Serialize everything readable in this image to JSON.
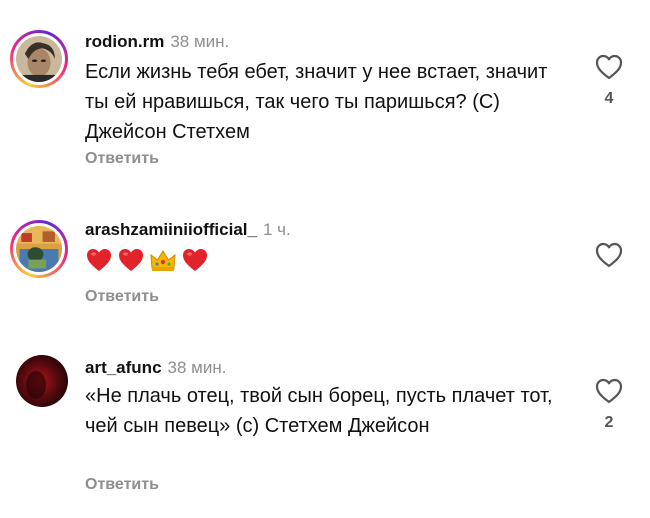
{
  "comments": [
    {
      "username": "rodion.rm",
      "time": "38 мин.",
      "text": "Если жизнь тебя ебет, значит у нее встает, значит ты ей нравишься, так чего ты паришься? (C) Джейсон Стетхем",
      "reply_label": "Ответить",
      "likes": "4"
    },
    {
      "username": "arashzamiiniiofficial_",
      "time": "1 ч.",
      "emojis": [
        "red-heart",
        "red-heart",
        "crown",
        "red-heart"
      ],
      "reply_label": "Ответить",
      "likes": ""
    },
    {
      "username": "art_afunc",
      "time": "38 мин.",
      "text": "«Не плачь отец, твой сын борец, пусть плачет тот, чей сын певец» (c) Стетхем Джейсон",
      "reply_label": "Ответить",
      "likes": "2"
    }
  ],
  "colors": {
    "text": "#111111",
    "secondary": "#8e8e8e",
    "heart": "#e0245e",
    "story_ring": "#ee2a7b"
  }
}
